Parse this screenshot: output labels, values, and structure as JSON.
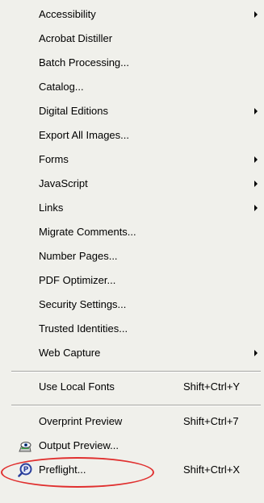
{
  "menu": {
    "items": [
      {
        "label": "Accessibility",
        "submenu": true
      },
      {
        "label": "Acrobat Distiller"
      },
      {
        "label": "Batch Processing..."
      },
      {
        "label": "Catalog..."
      },
      {
        "label": "Digital Editions",
        "submenu": true
      },
      {
        "label": "Export All Images..."
      },
      {
        "label": "Forms",
        "submenu": true
      },
      {
        "label": "JavaScript",
        "submenu": true
      },
      {
        "label": "Links",
        "submenu": true
      },
      {
        "label": "Migrate Comments..."
      },
      {
        "label": "Number Pages..."
      },
      {
        "label": "PDF Optimizer..."
      },
      {
        "label": "Security Settings..."
      },
      {
        "label": "Trusted Identities..."
      },
      {
        "label": "Web Capture",
        "submenu": true
      }
    ],
    "fonts_item": {
      "label": "Use Local Fonts",
      "shortcut": "Shift+Ctrl+Y"
    },
    "print_items": [
      {
        "label": "Overprint Preview",
        "shortcut": "Shift+Ctrl+7"
      },
      {
        "label": "Output Preview...",
        "icon": "output-preview-icon"
      },
      {
        "label": "Preflight...",
        "shortcut": "Shift+Ctrl+X",
        "icon": "preflight-icon"
      }
    ]
  },
  "colors": {
    "menu_bg": "#f0f0eb",
    "highlight_ring": "#e0302f",
    "separator": "#a5a5a0"
  }
}
